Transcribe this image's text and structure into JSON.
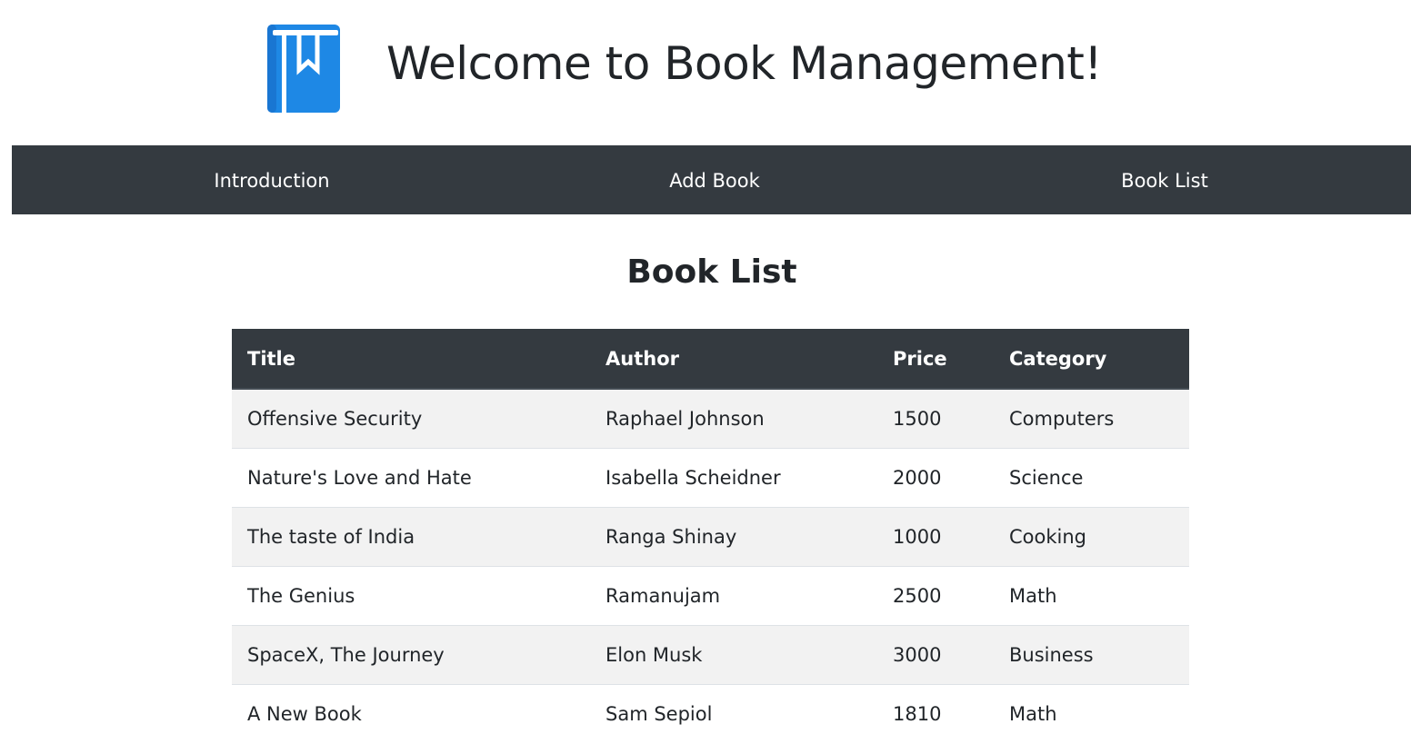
{
  "header": {
    "logo_icon": "book-bookmark-icon",
    "title": "Welcome to Book Management!"
  },
  "nav": {
    "items": [
      {
        "label": "Introduction"
      },
      {
        "label": "Add Book"
      },
      {
        "label": "Book List"
      }
    ]
  },
  "main": {
    "heading": "Book List",
    "table": {
      "columns": [
        "Title",
        "Author",
        "Price",
        "Category"
      ],
      "rows": [
        {
          "title": "Offensive Security",
          "author": "Raphael Johnson",
          "price": "1500",
          "category": "Computers"
        },
        {
          "title": "Nature's Love and Hate",
          "author": "Isabella Scheidner",
          "price": "2000",
          "category": "Science"
        },
        {
          "title": "The taste of India",
          "author": "Ranga Shinay",
          "price": "1000",
          "category": "Cooking"
        },
        {
          "title": "The Genius",
          "author": "Ramanujam",
          "price": "2500",
          "category": "Math"
        },
        {
          "title": "SpaceX, The Journey",
          "author": "Elon Musk",
          "price": "3000",
          "category": "Business"
        },
        {
          "title": "A New Book",
          "author": "Sam Sepiol",
          "price": "1810",
          "category": "Math"
        }
      ]
    }
  },
  "colors": {
    "accent": "#1e88e5",
    "navbar_bg": "#343a40",
    "table_header_bg": "#343a40",
    "stripe_bg": "#f2f2f2"
  }
}
